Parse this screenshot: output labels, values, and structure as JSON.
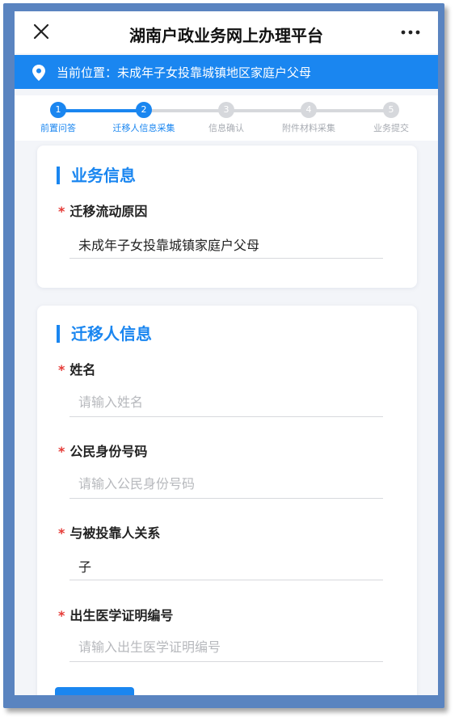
{
  "app": {
    "title": "湖南户政业务网上办理平台"
  },
  "location": {
    "prefix": "当前位置：",
    "path": "未成年子女投靠城镇地区家庭户父母"
  },
  "steps": [
    {
      "num": "1",
      "label": "前置问答",
      "state": "done"
    },
    {
      "num": "2",
      "label": "迁移人信息采集",
      "state": "active"
    },
    {
      "num": "3",
      "label": "信息确认",
      "state": "pending"
    },
    {
      "num": "4",
      "label": "附件材料采集",
      "state": "pending"
    },
    {
      "num": "5",
      "label": "业务提交",
      "state": "pending"
    }
  ],
  "business_info": {
    "title": "业务信息",
    "reason_label": "迁移流动原因",
    "reason_value": "未成年子女投靠城镇家庭户父母"
  },
  "mover_info": {
    "title": "迁移人信息",
    "name_label": "姓名",
    "name_placeholder": "请输入姓名",
    "id_label": "公民身份号码",
    "id_placeholder": "请输入公民身份号码",
    "relation_label": "与被投靠人关系",
    "relation_value": "子",
    "birth_label": "出生医学证明编号",
    "birth_placeholder": "请输入出生医学证明编号"
  },
  "required_mark": "*",
  "colors": {
    "accent": "#1a86f0",
    "required": "#e53935",
    "pending": "#d6d8dc",
    "frame": "#5a84c0"
  }
}
